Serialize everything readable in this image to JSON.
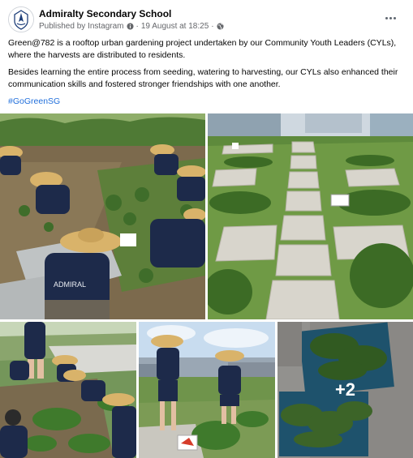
{
  "post": {
    "page_name": "Admiralty Secondary School",
    "published_by": "Published by Instagram",
    "date": "19 August at 18:25",
    "meta_sep": "·",
    "paragraphs": [
      "Green@782 is a rooftop urban gardening project undertaken by our Community Youth Leaders (CYLs), where the harvests are distributed to residents.",
      "Besides learning the entire process from seeding, watering to harvesting, our CYLs also enhanced their communication skills and fostered stronger friendships with one another."
    ],
    "hashtag": "#GoGreenSG",
    "extra_photos": "+2",
    "shirt_text": "ADMIRAL"
  },
  "icons": {
    "more": "more-horizontal-icon",
    "info": "info-icon",
    "globe": "globe-icon"
  },
  "colors": {
    "hashtag": "#216fdb",
    "meta": "#65676b"
  }
}
